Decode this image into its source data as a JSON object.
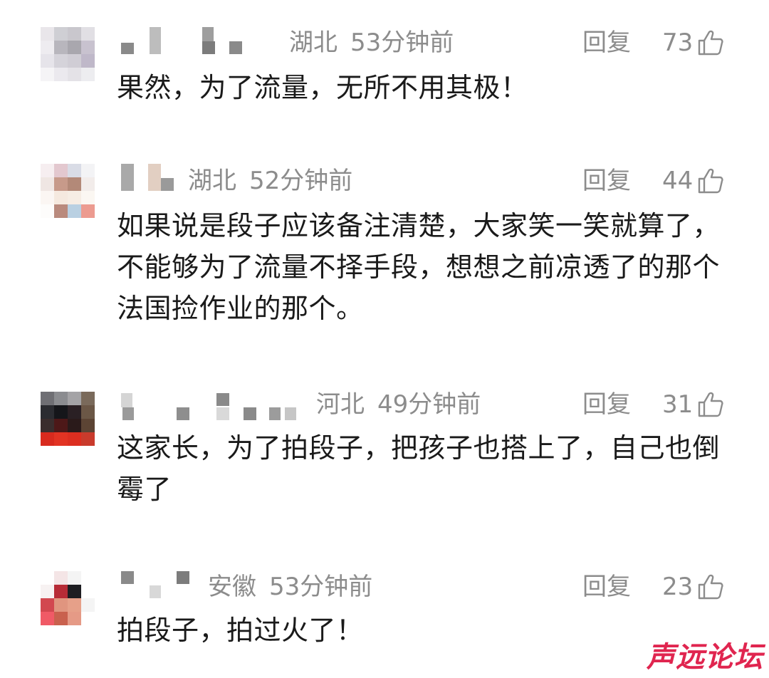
{
  "comments": [
    {
      "region": "湖北",
      "time": "53分钟前",
      "reply": "回复",
      "likes": "73",
      "text": "果然，为了流量，无所不用其极！"
    },
    {
      "region": "湖北",
      "time": "52分钟前",
      "reply": "回复",
      "likes": "44",
      "text": "如果说是段子应该备注清楚，大家笑一笑就算了，不能够为了流量不择手段，想想之前凉透了的那个法国捡作业的那个。"
    },
    {
      "region": "河北",
      "time": "49分钟前",
      "reply": "回复",
      "likes": "31",
      "text": "这家长，为了拍段子，把孩子也搭上了，自己也倒霉了"
    },
    {
      "region": "安徽",
      "time": "53分钟前",
      "reply": "回复",
      "likes": "23",
      "text": "拍段子，拍过火了！"
    }
  ],
  "watermark": "声远论坛",
  "icons": {
    "like": "thumbs-up-icon"
  },
  "colors": {
    "meta_text": "#8c8c8c",
    "body_text": "#1a1a1a",
    "watermark": "#e0254f"
  }
}
